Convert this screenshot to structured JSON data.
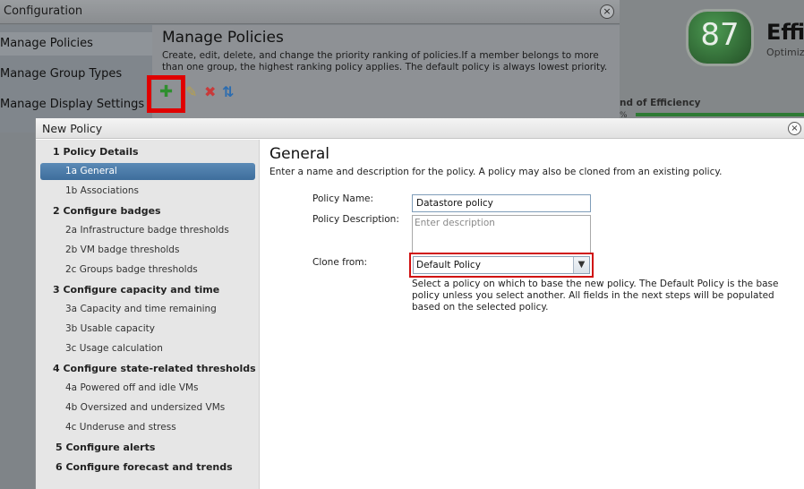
{
  "background": {
    "window_title": "Configuration",
    "close_glyph": "×",
    "sidebar": [
      {
        "label": "Manage Policies",
        "selected": true
      },
      {
        "label": "Manage Group Types"
      },
      {
        "label": "Manage Display Settings"
      }
    ],
    "main": {
      "title": "Manage Policies",
      "description": "Create, edit, delete, and change the priority ranking of policies.If a member belongs to more than one group, the highest ranking policy applies. The default policy is always lowest priority.",
      "toolbar": {
        "add_icon": "plus-icon",
        "edit_icon": "pencil-icon",
        "delete_icon": "x-icon",
        "reorder_icon": "up-down-arrows-icon"
      }
    },
    "badge": {
      "score": "87",
      "title": "Effic",
      "subtitle": "Optimiz"
    },
    "trend": {
      "label": "nd of Efficiency",
      "pct": "%"
    }
  },
  "dialog": {
    "title": "New Policy",
    "close_glyph": "×",
    "steps": [
      {
        "label": "1 Policy Details",
        "substeps": [
          "1a General",
          "1b Associations"
        ]
      },
      {
        "label": "2 Configure badges",
        "substeps": [
          "2a Infrastructure badge thresholds",
          "2b VM badge thresholds",
          "2c Groups badge thresholds"
        ]
      },
      {
        "label": "3 Configure capacity and time",
        "substeps": [
          "3a Capacity and time remaining",
          "3b Usable capacity",
          "3c Usage calculation"
        ]
      },
      {
        "label": "4 Configure state-related thresholds",
        "substeps": [
          "4a Powered off and idle VMs",
          "4b Oversized and undersized VMs",
          "4c Underuse and stress"
        ]
      },
      {
        "label": "5 Configure alerts",
        "substeps": []
      },
      {
        "label": "6 Configure forecast and trends",
        "substeps": []
      }
    ],
    "selected_step": "1a General",
    "general": {
      "title": "General",
      "description": "Enter a name and description for the policy. A policy may also be cloned from an existing policy.",
      "policy_name_label": "Policy Name:",
      "policy_name_value": "Datastore policy",
      "policy_desc_label": "Policy Description:",
      "policy_desc_placeholder": "Enter description",
      "clone_label": "Clone from:",
      "clone_value": "Default Policy",
      "clone_help": "Select a policy on which to base the new policy. The Default Policy is the base policy unless you select another. All fields in the next steps will be populated based on the selected policy."
    }
  },
  "colors": {
    "highlight": "#e00000",
    "selection": "#3e6e9c",
    "add_green": "#2f8f2f",
    "delete_red": "#c83a3a",
    "reorder_blue": "#2b6cb0"
  }
}
